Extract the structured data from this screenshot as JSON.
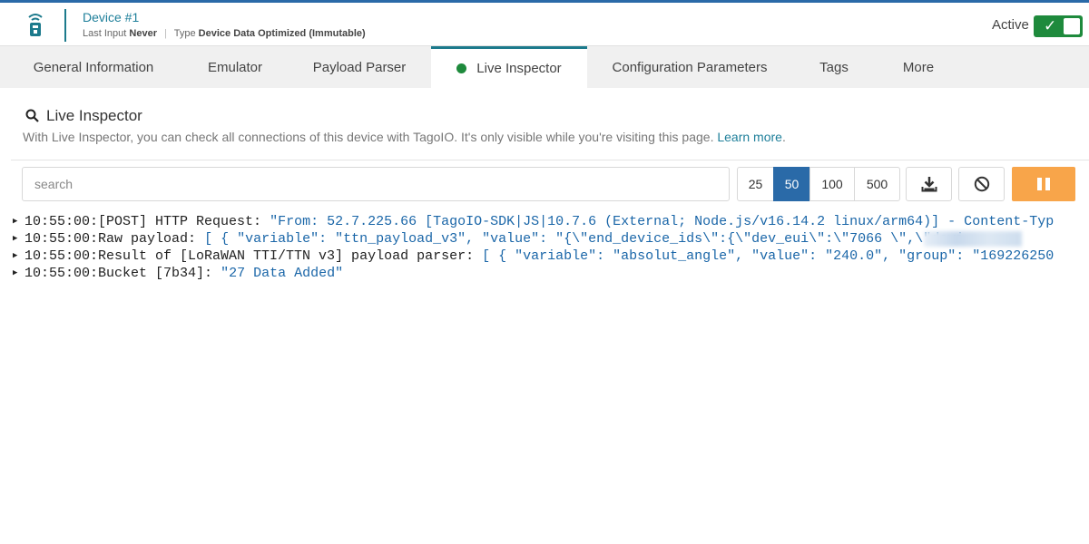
{
  "header": {
    "device_name": "Device #1",
    "last_input_label": "Last Input",
    "last_input_value": "Never",
    "type_label": "Type",
    "type_value": "Device Data Optimized (Immutable)",
    "active_label": "Active",
    "active_state": true,
    "toggle_glyph": "✓"
  },
  "tabs": [
    {
      "label": "General Information",
      "active": false
    },
    {
      "label": "Emulator",
      "active": false
    },
    {
      "label": "Payload Parser",
      "active": false
    },
    {
      "label": "Live Inspector",
      "active": true,
      "status_dot": "green"
    },
    {
      "label": "Configuration Parameters",
      "active": false
    },
    {
      "label": "Tags",
      "active": false
    },
    {
      "label": "More",
      "active": false
    }
  ],
  "section": {
    "title": "Live Inspector",
    "icon": "search-icon",
    "description": "With Live Inspector, you can check all connections of this device with TagoIO. It's only visible while you're visiting this page.",
    "learn_more": "Learn more"
  },
  "toolbar": {
    "search_placeholder": "search",
    "page_sizes": [
      "25",
      "50",
      "100",
      "500"
    ],
    "selected_page_size": "50",
    "download_icon": "download-icon",
    "clear_icon": "ban-icon",
    "pause_icon": "pause-icon"
  },
  "log": [
    {
      "time": "10:55:00:",
      "key": "[POST] HTTP Request:",
      "value": "\"From: 52.7.225.66 [TagoIO-SDK|JS|10.7.6 (External; Node.js/v16.14.2 linux/arm64)] - Content-Typ"
    },
    {
      "time": "10:55:00:",
      "key": "Raw payload:",
      "value": "[ { \"variable\": \"ttn_payload_v3\", \"value\": \"{\\\"end_device_ids\\\":{\\\"dev_eui\\\":\\\"7066              \\\",\\\"devi"
    },
    {
      "time": "10:55:00:",
      "key": "Result of [LoRaWAN TTI/TTN v3] payload parser:",
      "value": "[ { \"variable\": \"absolut_angle\", \"value\": \"240.0\", \"group\": \"169226250"
    },
    {
      "time": "10:55:00:",
      "key": "Bucket [7b34]:",
      "value": "\"27 Data Added\""
    }
  ],
  "colors": {
    "accent": "#1c7a8c",
    "selected": "#2a6aa8",
    "active_green": "#1e8a3c",
    "pause": "#f8a54a",
    "log_value": "#1a66a8"
  }
}
